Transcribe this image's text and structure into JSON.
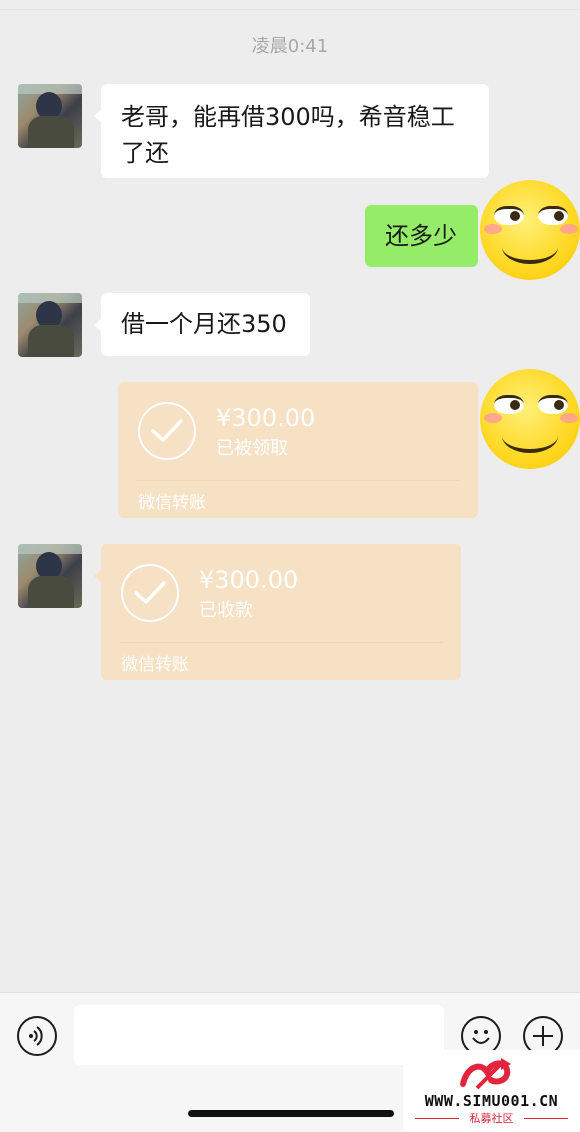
{
  "chat": {
    "timestamp": "凌晨0:41",
    "messages": [
      {
        "from": "other",
        "type": "text",
        "text": "老哥，能再借300吗，希音稳工了还"
      },
      {
        "from": "me",
        "type": "text",
        "text": "还多少"
      },
      {
        "from": "other",
        "type": "text",
        "text": "借一个月还350"
      },
      {
        "from": "me",
        "type": "transfer",
        "amount": "¥300.00",
        "status": "已被领取",
        "caption": "微信转账"
      },
      {
        "from": "other",
        "type": "transfer",
        "amount": "¥300.00",
        "status": "已收款",
        "caption": "微信转账"
      }
    ]
  },
  "input_bar": {
    "voice_icon": "voice-icon",
    "emoji_icon": "smiley-icon",
    "plus_icon": "plus-icon"
  },
  "watermark": {
    "site": "WWW.SIMU001.CN",
    "name": "私募社区"
  },
  "colors": {
    "background": "#ededed",
    "bubble_green": "#95ec69",
    "bubble_white": "#ffffff",
    "transfer": "#f6e1c4"
  }
}
